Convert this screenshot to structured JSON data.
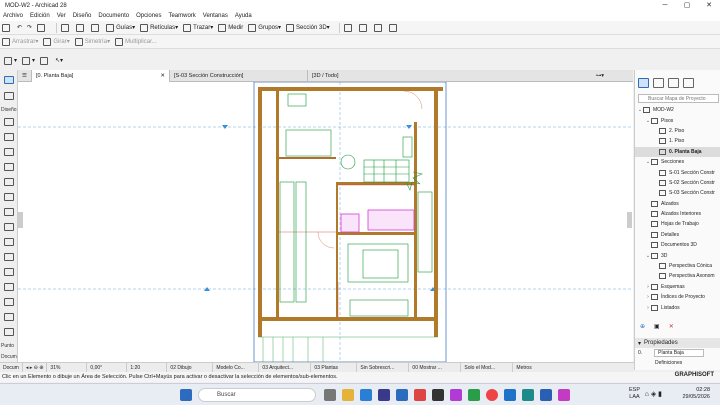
{
  "window": {
    "title": "MOD-W2 - Archicad 28"
  },
  "menu": [
    "Archivo",
    "Edición",
    "Ver",
    "Diseño",
    "Documento",
    "Opciones",
    "Teamwork",
    "Ventanas",
    "Ayuda"
  ],
  "toolbar1": {
    "guias": "Guías",
    "reticulas": "Retículas",
    "trazar": "Trazar",
    "medir": "Medir",
    "grupos": "Grupos",
    "seccion3d": "Sección 3D"
  },
  "toolbar2": {
    "arrastrar": "Arrastrar",
    "girar": "Girar",
    "simetria": "Simetría",
    "multiplicar": "Multiplicar..."
  },
  "toolbox": {
    "diseno": "Diseño",
    "punto": "Punto",
    "docum": "Docum"
  },
  "tabs": [
    "[0. Planta Baja]",
    "[S-03 Sección Construcción]",
    "[3D / Todo]"
  ],
  "navigator": {
    "search_placeholder": "Buscar Mapa de Proyecto",
    "items": [
      {
        "label": "MOD-W2",
        "level": 0,
        "arrow": "v"
      },
      {
        "label": "Pisos",
        "level": 1,
        "arrow": "v"
      },
      {
        "label": "2. Piso",
        "level": 2,
        "arrow": ""
      },
      {
        "label": "1. Piso",
        "level": 2,
        "arrow": ""
      },
      {
        "label": "0. Planta Baja",
        "level": 2,
        "arrow": "",
        "selected": true
      },
      {
        "label": "Secciones",
        "level": 1,
        "arrow": "v"
      },
      {
        "label": "S-01 Sección Constr",
        "level": 2,
        "arrow": ""
      },
      {
        "label": "S-02 Sección Constr",
        "level": 2,
        "arrow": ""
      },
      {
        "label": "S-03 Sección Constr",
        "level": 2,
        "arrow": ""
      },
      {
        "label": "Alzados",
        "level": 1,
        "arrow": ""
      },
      {
        "label": "Alzados Interiores",
        "level": 1,
        "arrow": ""
      },
      {
        "label": "Hojas de Trabajo",
        "level": 1,
        "arrow": ""
      },
      {
        "label": "Detalles",
        "level": 1,
        "arrow": ""
      },
      {
        "label": "Documentos 3D",
        "level": 1,
        "arrow": ""
      },
      {
        "label": "3D",
        "level": 1,
        "arrow": "v"
      },
      {
        "label": "Perspectiva Cónica",
        "level": 2,
        "arrow": ""
      },
      {
        "label": "Perspectiva Axonom",
        "level": 2,
        "arrow": ""
      },
      {
        "label": "Esquemas",
        "level": 1,
        "arrow": ">"
      },
      {
        "label": "Índices de Proyecto",
        "level": 1,
        "arrow": ">"
      },
      {
        "label": "Listados",
        "level": 1,
        "arrow": ">"
      }
    ],
    "properties": "Propiedades",
    "prop_num": "0.",
    "prop_val": "Planta Baja",
    "definitions": "Definiciones"
  },
  "status": {
    "zoom": "31%",
    "angle": "0,00°",
    "scale": "1:20",
    "dibujo": "02 Dibujo",
    "modelo": "Modelo Co...",
    "arquitect": "03 Arquitect...",
    "plantas": "03 Plantas",
    "sobrescr": "Sin Sobrescri...",
    "mostrar": "00 Mostrar ...",
    "solo": "Solo el Mod...",
    "unidad": "Metros"
  },
  "hint": "Clic en un Elemento o dibuje un Área de Selección. Pulse Ctrl+Mayús para activar o desactivar la selección de elementos/sub-elementos.",
  "brand": "GRAPHISOFT",
  "taskbar": {
    "search": "Buscar",
    "lang1": "ESP",
    "lang2": "LAA",
    "time": "02:28",
    "date": "29/05/2026"
  },
  "colors": {
    "wall": "#b07a2a",
    "furniture": "#1a9a3a",
    "magenta": "#d63ad6",
    "guide": "#3a8fd6",
    "select": "#cfe2f7"
  }
}
